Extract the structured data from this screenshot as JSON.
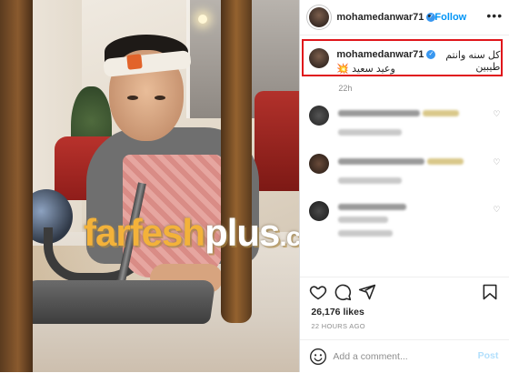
{
  "header": {
    "username": "mohamedanwar71",
    "separator": "•",
    "follow_label": "Follow",
    "more_icon": "more-options-icon"
  },
  "caption": {
    "username": "mohamedanwar71",
    "line1": "كل سنه وانتم طيبين",
    "line2": "وعيد سعيد 💥",
    "time": "22h",
    "highlight_color": "#e0161b"
  },
  "image": {
    "watermark": {
      "part1": "farfesh",
      "part2": "plus",
      "part3": ".com"
    }
  },
  "actions": {
    "like_icon": "heart-icon",
    "comment_icon": "comment-icon",
    "share_icon": "share-icon",
    "save_icon": "bookmark-icon"
  },
  "likes": "26,176 likes",
  "posted_time": "22 HOURS AGO",
  "add_comment": {
    "placeholder": "Add a comment...",
    "post_label": "Post",
    "emoji_icon": "emoji-icon"
  },
  "colors": {
    "follow": "#0095f6",
    "verified": "#3897f0",
    "post_disabled": "#b2dffc"
  }
}
